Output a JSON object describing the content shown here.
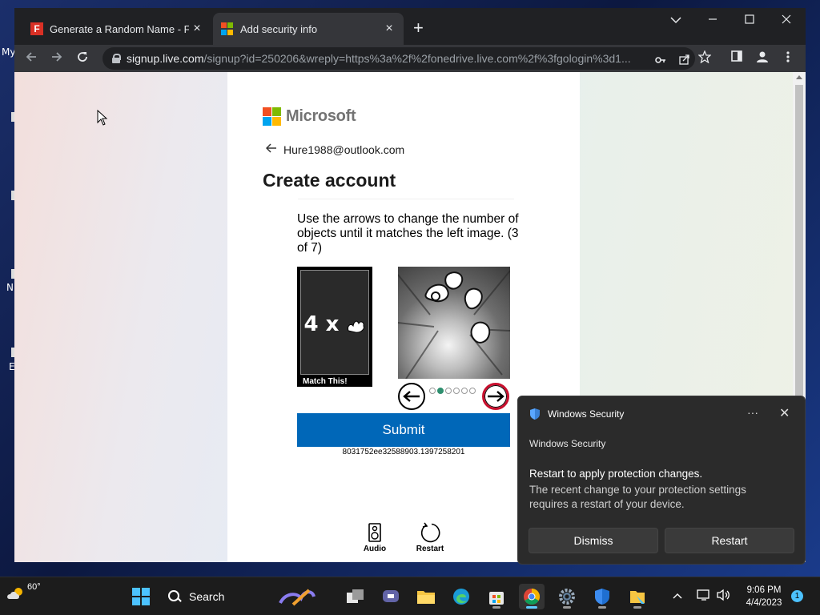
{
  "desktop": {
    "labels": [
      "My",
      "N",
      "E"
    ]
  },
  "browser": {
    "tabs": [
      {
        "title": "Generate a Random Name - Fake Name Generator",
        "close": "×"
      },
      {
        "title": "Add security info",
        "close": "×"
      }
    ],
    "new_tab": "+",
    "url_host": "signup.live.com",
    "url_path": "/signup?id=250206&wreply=https%3a%2f%2fonedrive.live.com%2f%3fgologin%3d1..."
  },
  "page": {
    "brand": "Microsoft",
    "email": "Hure1988@outlook.com",
    "title": "Create account",
    "instructions": "Use the arrows to change the number of objects until it matches the left image. (3 of 7)",
    "match_label": "4 x",
    "match_caption": "Match This!",
    "dots_total": 6,
    "dots_active_index": 1,
    "submit_label": "Submit",
    "session_id": "8031752ee32588903.1397258201",
    "audio_label": "Audio",
    "restart_label": "Restart"
  },
  "notification": {
    "app": "Windows Security",
    "source": "Windows Security",
    "title": "Restart to apply protection changes.",
    "body": "The recent change to your protection settings requires a restart of your device.",
    "dismiss_label": "Dismiss",
    "restart_label": "Restart",
    "more": "···",
    "close": "✕"
  },
  "taskbar": {
    "weather": "60°",
    "search_label": "Search",
    "time": "9:06 PM",
    "date": "4/4/2023",
    "notification_count": "1"
  },
  "colors": {
    "ms_red": "#f25022",
    "ms_green": "#7fba00",
    "ms_blue": "#00a4ef",
    "ms_yellow": "#ffb900",
    "submit_blue": "#0067b8",
    "arrow_red": "#c8102e"
  }
}
